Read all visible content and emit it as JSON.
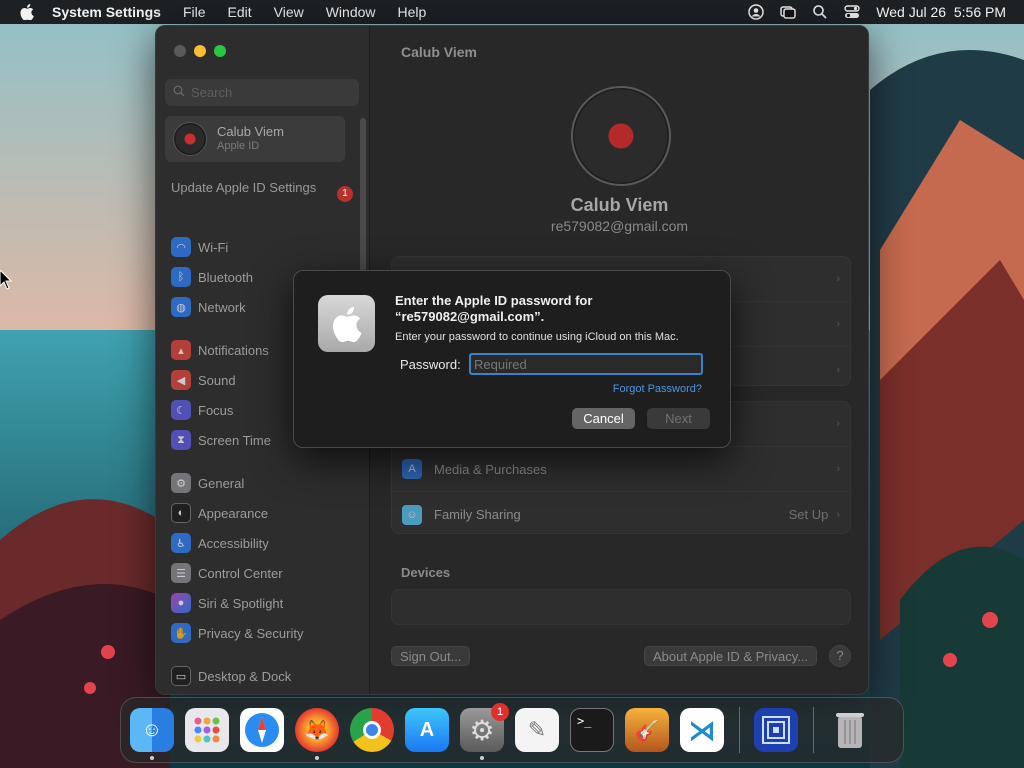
{
  "menubar": {
    "app_name": "System Settings",
    "menus": [
      "File",
      "Edit",
      "View",
      "Window",
      "Help"
    ],
    "clock": "Wed Jul 26  5:56 PM"
  },
  "sidebar": {
    "search_placeholder": "Search",
    "account": {
      "name": "Calub Viem",
      "subtitle": "Apple ID"
    },
    "update_label": "Update Apple ID Settings",
    "update_badge": "1",
    "items": [
      {
        "label": "Wi-Fi",
        "icon": "wifi-icon",
        "color": "#2f7ff5"
      },
      {
        "label": "Bluetooth",
        "icon": "bluetooth-icon",
        "color": "#2f7ff5"
      },
      {
        "label": "Network",
        "icon": "globe-icon",
        "color": "#2f7ff5"
      },
      {
        "label": "Notifications",
        "icon": "bell-icon",
        "color": "#e0453d"
      },
      {
        "label": "Sound",
        "icon": "speaker-icon",
        "color": "#e0453d"
      },
      {
        "label": "Focus",
        "icon": "moon-icon",
        "color": "#5e5ce6"
      },
      {
        "label": "Screen Time",
        "icon": "hourglass-icon",
        "color": "#5e5ce6"
      },
      {
        "label": "General",
        "icon": "gear-icon",
        "color": "#8e8e93"
      },
      {
        "label": "Appearance",
        "icon": "appearance-icon",
        "color": "#1c1c1e"
      },
      {
        "label": "Accessibility",
        "icon": "accessibility-icon",
        "color": "#2f7ff5"
      },
      {
        "label": "Control Center",
        "icon": "control-center-icon",
        "color": "#8e8e93"
      },
      {
        "label": "Siri & Spotlight",
        "icon": "siri-icon",
        "color": "#c54ad8"
      },
      {
        "label": "Privacy & Security",
        "icon": "hand-icon",
        "color": "#2f7ff5"
      },
      {
        "label": "Desktop & Dock",
        "icon": "dock-icon",
        "color": "#1c1c1e"
      }
    ]
  },
  "main": {
    "title": "Calub Viem",
    "name": "Calub Viem",
    "email": "re579082@gmail.com",
    "rows": [
      {
        "label": "Media & Purchases",
        "value": "",
        "icon": "app-store-icon",
        "color": "#2f7ff5"
      },
      {
        "label": "Family Sharing",
        "value": "Set Up",
        "icon": "family-icon",
        "color": "#5ac8fa"
      }
    ],
    "devices_title": "Devices",
    "sign_out": "Sign Out...",
    "about": "About Apple ID & Privacy...",
    "help": "?"
  },
  "dialog": {
    "title": "Enter the Apple ID password for “re579082@gmail.com”.",
    "subtitle": "Enter your password to continue using iCloud on this Mac.",
    "password_label": "Password:",
    "password_placeholder": "Required",
    "forgot": "Forgot Password?",
    "cancel": "Cancel",
    "next": "Next"
  },
  "dock": {
    "apps": [
      "Finder",
      "Launchpad",
      "Safari",
      "Firefox",
      "Chrome",
      "App Store",
      "System Settings",
      "TextEdit",
      "Terminal",
      "GarageBand",
      "Visual Studio Code"
    ],
    "settings_badge": "1",
    "minimized": "Window",
    "trash": "Trash"
  }
}
